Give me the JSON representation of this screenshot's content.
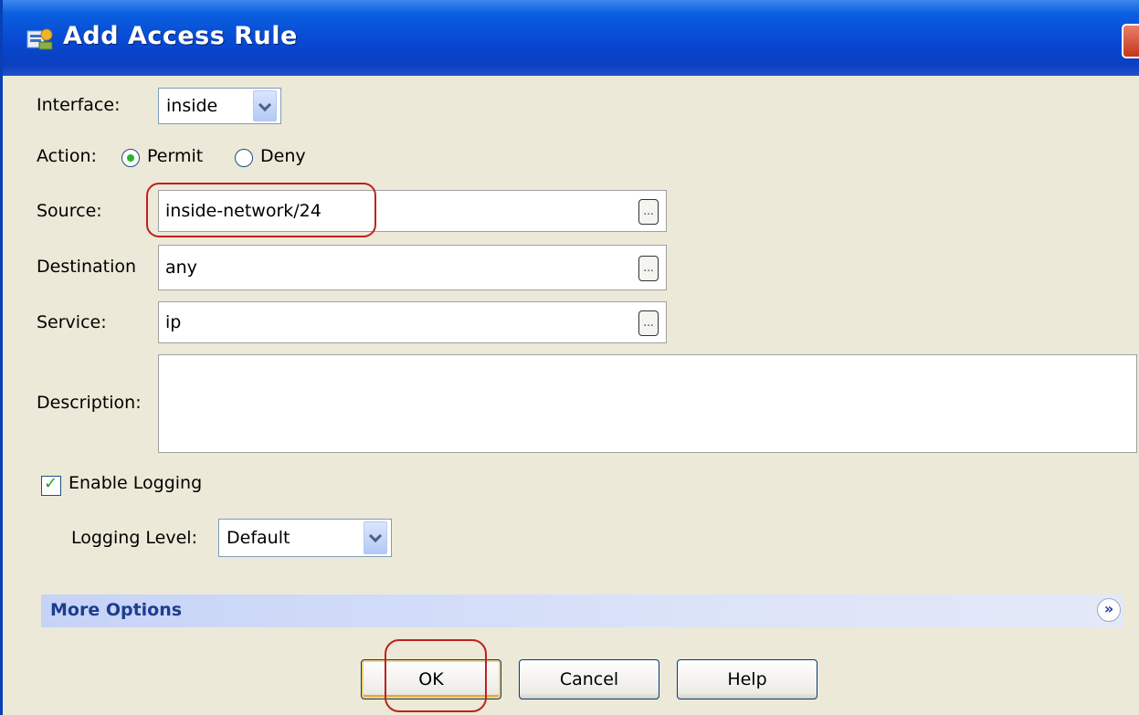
{
  "dialog": {
    "title": "Add Access Rule"
  },
  "form": {
    "interface_label": "Interface:",
    "interface_value": "inside",
    "action_label": "Action:",
    "action_permit": "Permit",
    "action_deny": "Deny",
    "action_selected": "Permit",
    "source_label": "Source:",
    "source_value": "inside-network/24",
    "destination_label": "Destination",
    "destination_value": "any",
    "service_label": "Service:",
    "service_value": "ip",
    "description_label": "Description:",
    "description_value": "",
    "browse_label": "...",
    "enable_logging_label": "Enable Logging",
    "enable_logging_checked": true,
    "logging_level_label": "Logging Level:",
    "logging_level_value": "Default"
  },
  "more_options": {
    "label": "More Options",
    "expand_icon": "double-chevron-down-icon"
  },
  "buttons": {
    "ok": "OK",
    "cancel": "Cancel",
    "help": "Help"
  },
  "colors": {
    "titlebar": "#0848d2",
    "highlight_ring": "#c21f1f",
    "panel": "#ece9d8",
    "more_options_text": "#1d3d8f"
  }
}
